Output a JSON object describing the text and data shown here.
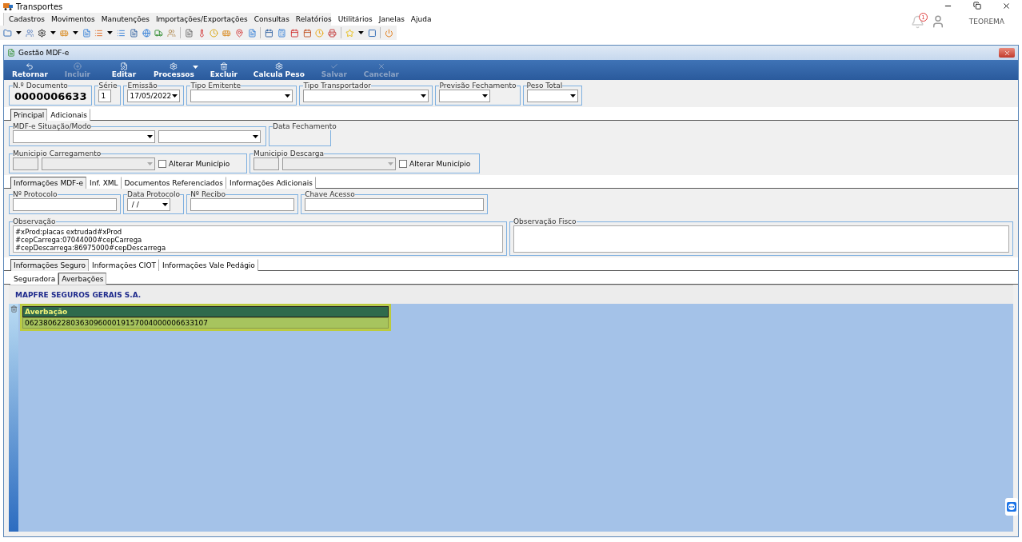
{
  "app": {
    "title": "Transportes",
    "menu": [
      "Cadastros",
      "Movimentos",
      "Manutenções",
      "Importações/Exportações",
      "Consultas",
      "Relatórios",
      "Utilitários",
      "Janelas",
      "Ajuda"
    ],
    "notification_count": "1",
    "user": "TEOREMA"
  },
  "window": {
    "title": "Gestão MDF-e",
    "actions": [
      {
        "label": "Retornar",
        "disabled": false,
        "kind": "back"
      },
      {
        "label": "Incluir",
        "disabled": true,
        "kind": "add"
      },
      {
        "label": "Editar",
        "disabled": false,
        "kind": "edit"
      },
      {
        "label": "Processos",
        "disabled": false,
        "kind": "process"
      },
      {
        "label": "Excluir",
        "disabled": false,
        "kind": "delete"
      },
      {
        "label": "Calcula Peso",
        "disabled": false,
        "kind": "calc"
      },
      {
        "label": "Salvar",
        "disabled": true,
        "kind": "save"
      },
      {
        "label": "Cancelar",
        "disabled": true,
        "kind": "cancel"
      }
    ]
  },
  "header": [
    {
      "label": "N.º Documento",
      "kind": "big",
      "value": "0000006633"
    },
    {
      "label": "Série",
      "kind": "small",
      "value": "1"
    },
    {
      "label": "Emissão",
      "kind": "combo",
      "value": "17/05/2022"
    },
    {
      "label": "Tipo Emitente",
      "kind": "wide-combo"
    },
    {
      "label": "Tipo Transportador",
      "kind": "wider-combo"
    },
    {
      "label": "Previsão Fechamento",
      "kind": "combo"
    },
    {
      "label": "Peso Total",
      "kind": "combo"
    }
  ],
  "main_tabs": [
    {
      "label": "Principal",
      "selected": true
    },
    {
      "label": "Adicionais",
      "selected": false
    }
  ],
  "situacao": {
    "label": "MDF-e Situação/Modo"
  },
  "data_fechamento": {
    "label": "Data Fechamento"
  },
  "municipios": [
    {
      "label": "Municipio Carregamento",
      "checkbox": "Alterar Município",
      "checked": false
    },
    {
      "label": "Municipio Descarga",
      "checkbox": "Alterar Município",
      "checked": false
    }
  ],
  "detail_tabs": [
    {
      "label": "Informações MDF-e",
      "selected": true
    },
    {
      "label": "Inf. XML",
      "selected": false
    },
    {
      "label": "Documentos Referenciados",
      "selected": false
    },
    {
      "label": "Informações Adicionais",
      "selected": false
    }
  ],
  "protocol_fields": [
    {
      "label": "Nº Protocolo",
      "kind": "text"
    },
    {
      "label": "Data Protocolo",
      "kind": "date",
      "value": " / /"
    },
    {
      "label": "Nº Recibo",
      "kind": "text"
    },
    {
      "label": "Chave Acesso",
      "kind": "key"
    }
  ],
  "observacao": {
    "label": "Observação",
    "lines": [
      "#xProd:placas extrudad#xProd",
      "#cepCarrega:07044000#cepCarrega",
      "#cepDescarrega:86975000#cepDescarrega"
    ]
  },
  "observacao_fisco": {
    "label": "Observação Fisco"
  },
  "seguro_tabs": [
    {
      "label": "Informações Seguro",
      "selected": true
    },
    {
      "label": "Informações CIOT",
      "selected": false
    },
    {
      "label": "Informações Vale Pedágio",
      "selected": false
    }
  ],
  "sub_tabs": [
    {
      "label": "Seguradora",
      "selected": false
    },
    {
      "label": "Averbações",
      "selected": true
    }
  ],
  "insurer": "MAPFRE SEGUROS GERAIS S.A.",
  "averbacao_table": {
    "columns": [
      "Averbação"
    ],
    "rows": [
      [
        "0623806228036309600019157004000006633107"
      ]
    ]
  }
}
